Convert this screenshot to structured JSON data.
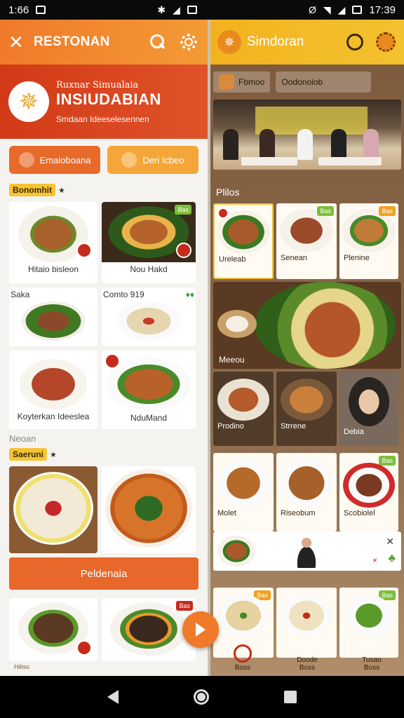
{
  "status_bar": {
    "time_left": "1:66",
    "time_right": "17:39"
  },
  "left": {
    "header": {
      "close_glyph": "✕",
      "title": "RESTONAN"
    },
    "hero": {
      "subtitle": "Ruxnar Simualaia",
      "title": "INSIUDABIAN",
      "tagline": "Smdaan Ideeselesennen"
    },
    "buttons": [
      {
        "label": "Emaioboana",
        "icon": "basket-icon"
      },
      {
        "label": "Deri Icbeo",
        "icon": "chat-icon"
      }
    ],
    "section1": {
      "tag": "Bonomhit",
      "star": "★"
    },
    "cards1": [
      {
        "label": "Hitaio bisleon"
      },
      {
        "label": "Nou Hakd",
        "badge": "Bas"
      }
    ],
    "row2_labels": [
      "Saka",
      "Comto 919",
      "♦♦"
    ],
    "cards2": [
      {
        "label": ""
      },
      {
        "label": ""
      }
    ],
    "cards3": [
      {
        "label": "Koyterkan Ideeslea"
      },
      {
        "label": "NduMand"
      }
    ],
    "section_plain": "Neoan",
    "section2": {
      "tag": "Saeruni",
      "star": "★"
    },
    "cta": "Peldenaia",
    "bottom_badge": "Bas",
    "bottom_label": "Hiliso",
    "fab_icon": "play-icon"
  },
  "right": {
    "header": {
      "title": "Simdoran"
    },
    "chips": [
      "Fbmoo",
      "Oodonoiob"
    ],
    "section": "Plilos",
    "row1": [
      {
        "label": "Ureleab"
      },
      {
        "label": "Senean",
        "badge": "Bas"
      },
      {
        "label": "Plenine",
        "badge": "Bas"
      }
    ],
    "big_label": "Meeou",
    "row2": [
      {
        "label": "Prodino"
      },
      {
        "label": "Strrene"
      },
      {
        "label": "Debia"
      }
    ],
    "row3": [
      {
        "label": "Molet"
      },
      {
        "label": "Riseobum"
      },
      {
        "label": "Scobiolel",
        "badge": "Bas"
      }
    ],
    "promo_close": "✕",
    "promo_small": "×",
    "row4_badges": [
      "Bas",
      "Bas"
    ],
    "bottom_nav": [
      "Boss",
      "Boss",
      "Boss"
    ],
    "bottom_nav_top": [
      "Doode",
      "Tusao"
    ]
  },
  "colors": {
    "left_header": "#f07a2a",
    "hero_red": "#d23a16",
    "right_header": "#f4b21f",
    "tag_yellow": "#f6c431"
  }
}
